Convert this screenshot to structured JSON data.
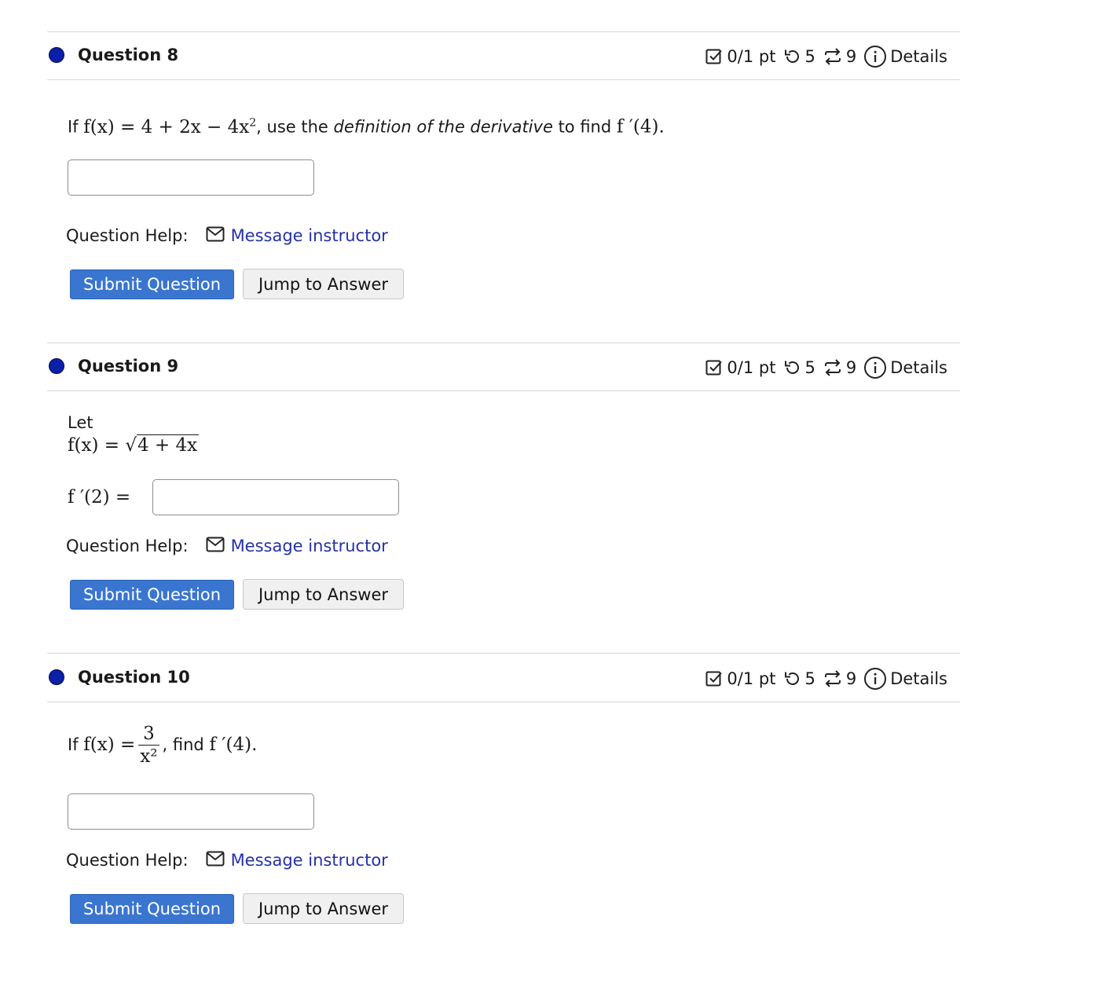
{
  "questions": [
    {
      "title": "Question 8",
      "score": "0/1 pt",
      "retries": "5",
      "attempts": "9",
      "details_label": "Details",
      "prompt": {
        "if_text": "If",
        "func": "f(x) = 4 + 2x − 4x",
        "exponent": "2",
        "after_func": ", use the",
        "emphasis": "definition of the derivative",
        "to_find": "to find",
        "target": "f ′(4)."
      },
      "help_label": "Question Help:",
      "message_link": "Message instructor",
      "submit_label": "Submit Question",
      "jump_label": "Jump to Answer"
    },
    {
      "title": "Question 9",
      "score": "0/1 pt",
      "retries": "5",
      "attempts": "9",
      "details_label": "Details",
      "prompt": {
        "let_text": "Let",
        "func_lhs": "f(x) =",
        "radicand": "4 + 4x",
        "answer_lhs": "f ′(2) ="
      },
      "help_label": "Question Help:",
      "message_link": "Message instructor",
      "submit_label": "Submit Question",
      "jump_label": "Jump to Answer"
    },
    {
      "title": "Question 10",
      "score": "0/1 pt",
      "retries": "5",
      "attempts": "9",
      "details_label": "Details",
      "prompt": {
        "if_text": "If",
        "func_lhs": "f(x) =",
        "numerator": "3",
        "denominator": "x²",
        "after_frac": ",",
        "find_text": "find",
        "target": "f ′(4)."
      },
      "help_label": "Question Help:",
      "message_link": "Message instructor",
      "submit_label": "Submit Question",
      "jump_label": "Jump to Answer"
    }
  ],
  "colors": {
    "status_dot": "#0b1fa8",
    "submit_button": "#3a75d0",
    "link": "#2431a6"
  }
}
